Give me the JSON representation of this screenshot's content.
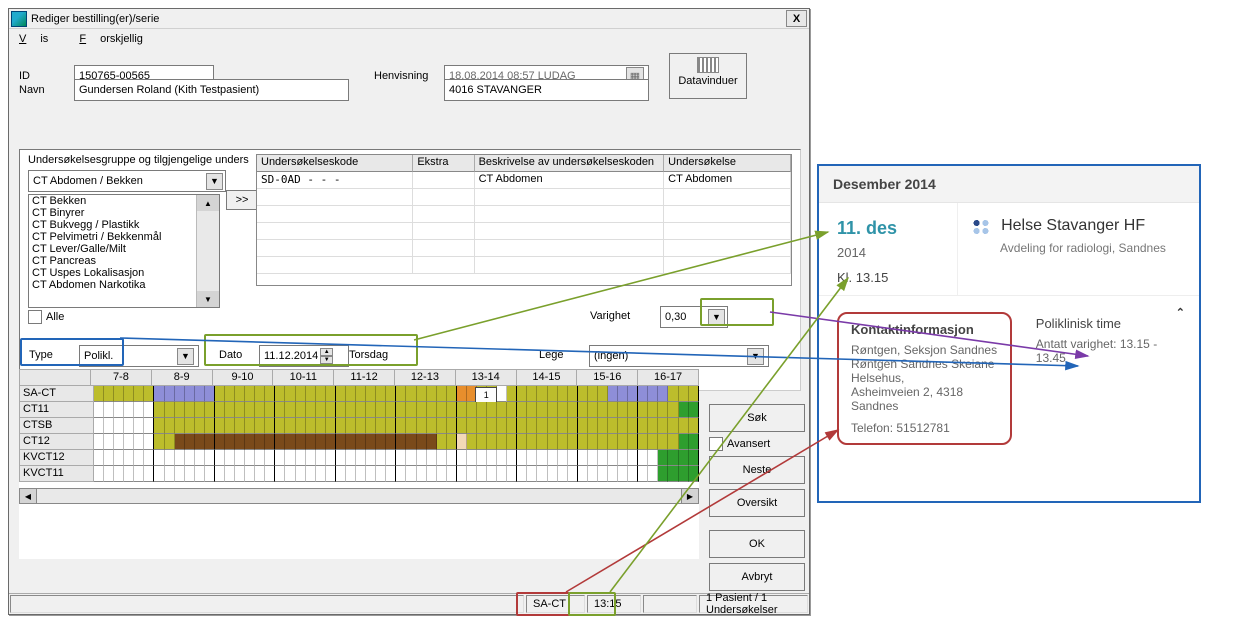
{
  "window": {
    "title": "Rediger bestilling(er)/serie",
    "menu": {
      "vis": "Vis",
      "forskjellig": "Forskjellig"
    },
    "close": "X"
  },
  "form": {
    "id_label": "ID",
    "id_value": "150765-00565",
    "navn_label": "Navn",
    "navn_value": "Gundersen Roland (Kith Testpasient)",
    "henvisning_label": "Henvisning",
    "henvisning_top": "18.08.2014 08:57 LUDAG",
    "henvisning_bottom": "4016 STAVANGER",
    "datavinduer_label": "Datavinduer"
  },
  "panel": {
    "group_label": "Undersøkelsesgruppe og tilgjengelige unders",
    "group_combo": "CT Abdomen / Bekken",
    "add_btn": ">>",
    "list": [
      "CT Bekken",
      "CT Binyrer",
      "CT Bukvegg / Plastikk",
      "CT Pelvimetri / Bekkenmål",
      "CT Lever/Galle/Milt",
      "CT Pancreas",
      "CT Uspes Lokalisasjon",
      "CT Abdomen Narkotika"
    ],
    "alle_label": "Alle",
    "table": {
      "cols": [
        "Undersøkelseskode",
        "Ekstra",
        "Beskrivelse av undersøkelseskoden",
        "Undersøkelse"
      ],
      "rows": [
        [
          "SD-0AD -   -  -",
          "",
          "CT Abdomen",
          "CT Abdomen"
        ]
      ]
    },
    "varighet_label": "Varighet",
    "varighet_value": "0,30"
  },
  "selrow": {
    "type_label": "Type",
    "type_value": "Polikl.",
    "dato_label": "Dato",
    "dato_value": "11.12.2014",
    "dato_day": "Torsdag",
    "lege_label": "Lege",
    "lege_value": "(ingen)"
  },
  "sched": {
    "hours": [
      "7-8",
      "8-9",
      "9-10",
      "10-11",
      "11-12",
      "12-13",
      "13-14",
      "14-15",
      "15-16",
      "16-17"
    ],
    "rooms": [
      "SA-CT",
      "CT11",
      "CTSB",
      "CT12",
      "KVCT12",
      "KVCT11"
    ],
    "appt_label": "1"
  },
  "actions": {
    "sok": "Søk",
    "avansert": "Avansert",
    "neste": "Neste",
    "oversikt": "Oversikt",
    "ok": "OK",
    "avbryt": "Avbryt"
  },
  "status": {
    "room": "SA-CT",
    "time": "13:15",
    "right": "1 Pasient / 1 Undersøkelser"
  },
  "card": {
    "header": "Desember 2014",
    "day": "11. des",
    "year": "2014",
    "time": "Kl. 13.15",
    "org": "Helse Stavanger HF",
    "dept": "Avdeling for radiologi, Sandnes",
    "contact_h": "Kontaktinformasjon",
    "contact_lines": [
      "Røntgen, Seksjon Sandnes",
      "Røntgen Sandnes Skeiane Helsehus,",
      "Asheimveien 2, 4318 Sandnes",
      "",
      "Telefon: 51512781"
    ],
    "poli_h": "Poliklinisk time",
    "poli_sub": "Antatt varighet: 13.15 - 13.45"
  }
}
